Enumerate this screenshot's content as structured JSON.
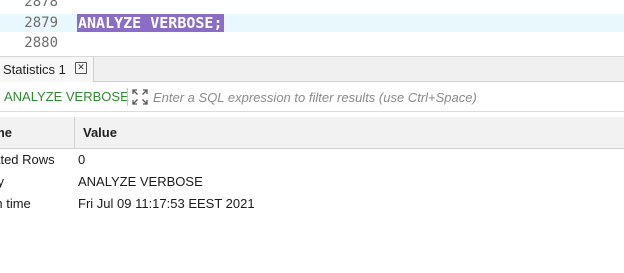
{
  "editor": {
    "lines": [
      {
        "number": "2878",
        "code": ""
      },
      {
        "number": "2879",
        "code": "ANALYZE VERBOSE;"
      },
      {
        "number": "2880",
        "code": ""
      }
    ]
  },
  "results_tab": {
    "label": "Statistics 1"
  },
  "filter": {
    "query_label": "ANALYZE VERBOSE",
    "placeholder": "Enter a SQL expression to filter results (use Ctrl+Space)"
  },
  "grid": {
    "columns": [
      "ame",
      "Value"
    ],
    "rows": [
      {
        "name": "dated Rows",
        "value": "0"
      },
      {
        "name": "ery",
        "value": "ANALYZE VERBOSE"
      },
      {
        "name": "ish time",
        "value": "Fri Jul 09 11:17:53 EEST 2021"
      }
    ]
  },
  "colors": {
    "selection": "#8b6cc6",
    "current_line": "#e8f8fd",
    "query_label": "#2e8b2e"
  }
}
